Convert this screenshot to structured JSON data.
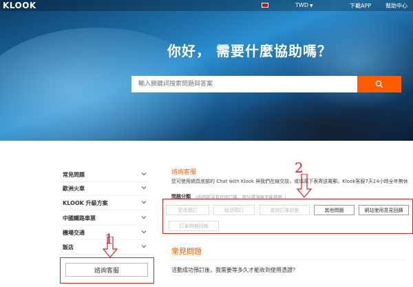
{
  "header": {
    "logo": "KLOOK",
    "currency": "TWD",
    "download_app": "下載APP",
    "help_center": "幫助中心"
  },
  "hero": {
    "title": "你好，  需要什麼協助嗎？",
    "search_placeholder": "輸入關鍵詞搜索問題與答案"
  },
  "sidebar": {
    "items": [
      {
        "label": "常見問題"
      },
      {
        "label": "歐洲火車"
      },
      {
        "label": "KLOOK 升級方案"
      },
      {
        "label": "中國鐵路車票"
      },
      {
        "label": "機場交通"
      },
      {
        "label": "飯店"
      }
    ],
    "contact_button": "諮詢客服"
  },
  "contact": {
    "title": "諮詢客服",
    "description": "您可使用網頁底部的 Chat with Klook 與我們在線交談，或填寫下表寄送電郵。Klook客服7天24小時全年無休",
    "category_label": "問題分類",
    "category_hint": "(你目前沒有任何訂單，部分選項將不能使用。)",
    "options": [
      {
        "label": "更改預訂",
        "enabled": false
      },
      {
        "label": "取消預訂",
        "enabled": false
      },
      {
        "label": "查詢訂單狀態",
        "enabled": false
      },
      {
        "label": "其他問題",
        "enabled": true
      },
      {
        "label": "網站使用意見回饋",
        "enabled": true
      },
      {
        "label": "訂單問題回報",
        "enabled": false
      }
    ]
  },
  "faq": {
    "title": "常見問題",
    "questions": [
      "活動成功預訂後，我需要等多久才能收到使用憑證？"
    ]
  },
  "annotations": {
    "marker_1": "1",
    "marker_2": "2"
  },
  "colors": {
    "accent": "#ff5b00",
    "annotation_red": "#d42020"
  }
}
